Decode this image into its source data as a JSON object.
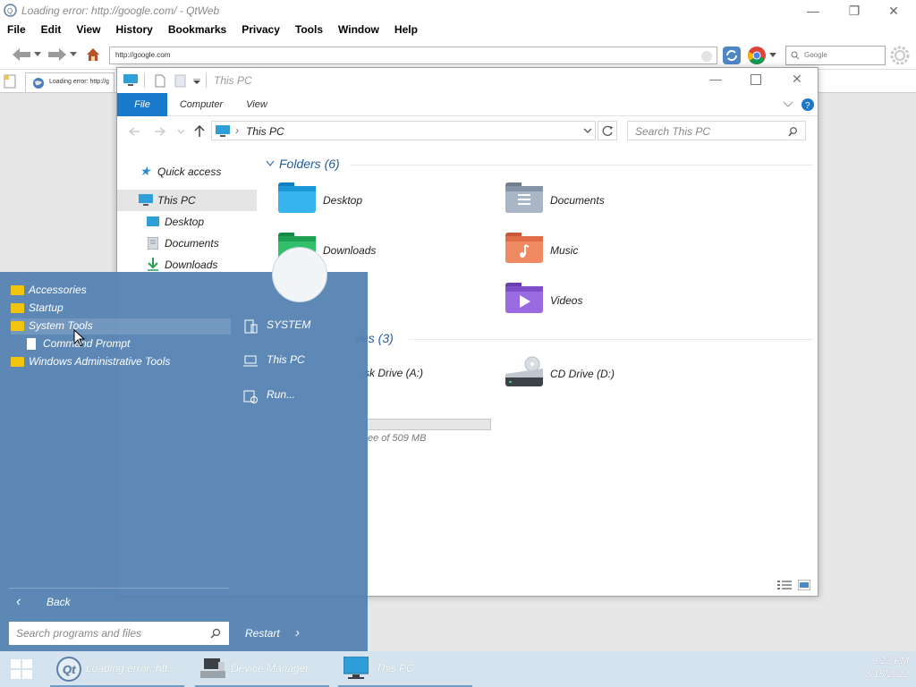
{
  "qtweb": {
    "title": "Loading error: http://google.com/ - QtWeb",
    "menu": [
      "File",
      "Edit",
      "View",
      "History",
      "Bookmarks",
      "Privacy",
      "Tools",
      "Window",
      "Help"
    ],
    "url": "http://google.com",
    "search_placeholder": "Google",
    "tab_title": "Loading error: http://g"
  },
  "explorer": {
    "title": "This PC",
    "ribbon_tabs": [
      "File",
      "Computer",
      "View"
    ],
    "address": "This PC",
    "search_placeholder": "Search This PC",
    "nav": [
      "Quick access",
      "This PC",
      "Desktop",
      "Documents",
      "Downloads"
    ],
    "folders_header": "Folders (6)",
    "folders": [
      "Desktop",
      "Documents",
      "Downloads",
      "Music",
      "Videos"
    ],
    "drives_header": "ves (3)",
    "drives": [
      "sk Drive (A:)",
      "CD Drive (D:)"
    ],
    "drive_free": "ee of 509 MB"
  },
  "startmenu": {
    "programs": [
      "Accessories",
      "Startup",
      "System Tools",
      "Command Prompt",
      "Windows Administrative Tools"
    ],
    "right": [
      "SYSTEM",
      "This PC",
      "Run..."
    ],
    "back": "Back",
    "search_placeholder": "Search programs and files",
    "restart": "Restart"
  },
  "taskbar": {
    "items": [
      "Loading error: htt...",
      "Device Manager",
      "This PC"
    ],
    "time": "8:23 PM",
    "date": "3/15/2022"
  },
  "colors": {
    "accent": "#1979ca",
    "start_bg": "#5280b2",
    "folder_yellow": "#f1c40f"
  }
}
